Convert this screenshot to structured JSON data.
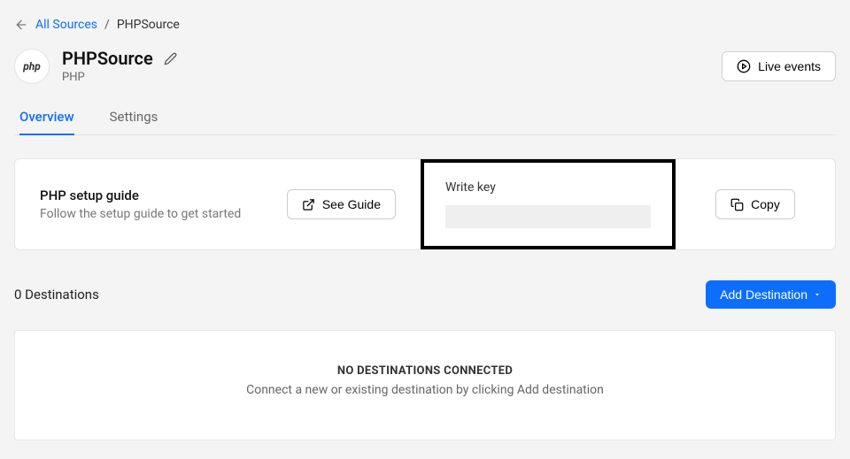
{
  "breadcrumb": {
    "back_label": "All Sources",
    "current": "PHPSource"
  },
  "header": {
    "logo_text": "php",
    "title": "PHPSource",
    "subtitle": "PHP",
    "live_events_label": "Live events"
  },
  "tabs": {
    "overview": "Overview",
    "settings": "Settings"
  },
  "setup": {
    "title": "PHP setup guide",
    "subtitle": "Follow the setup guide to get started",
    "see_guide_label": "See Guide",
    "write_key_label": "Write key",
    "write_key_value": "",
    "copy_label": "Copy"
  },
  "destinations": {
    "count_label": "0 Destinations",
    "add_label": "Add Destination",
    "empty_title": "NO DESTINATIONS CONNECTED",
    "empty_sub": "Connect a new or existing destination by clicking Add destination"
  }
}
